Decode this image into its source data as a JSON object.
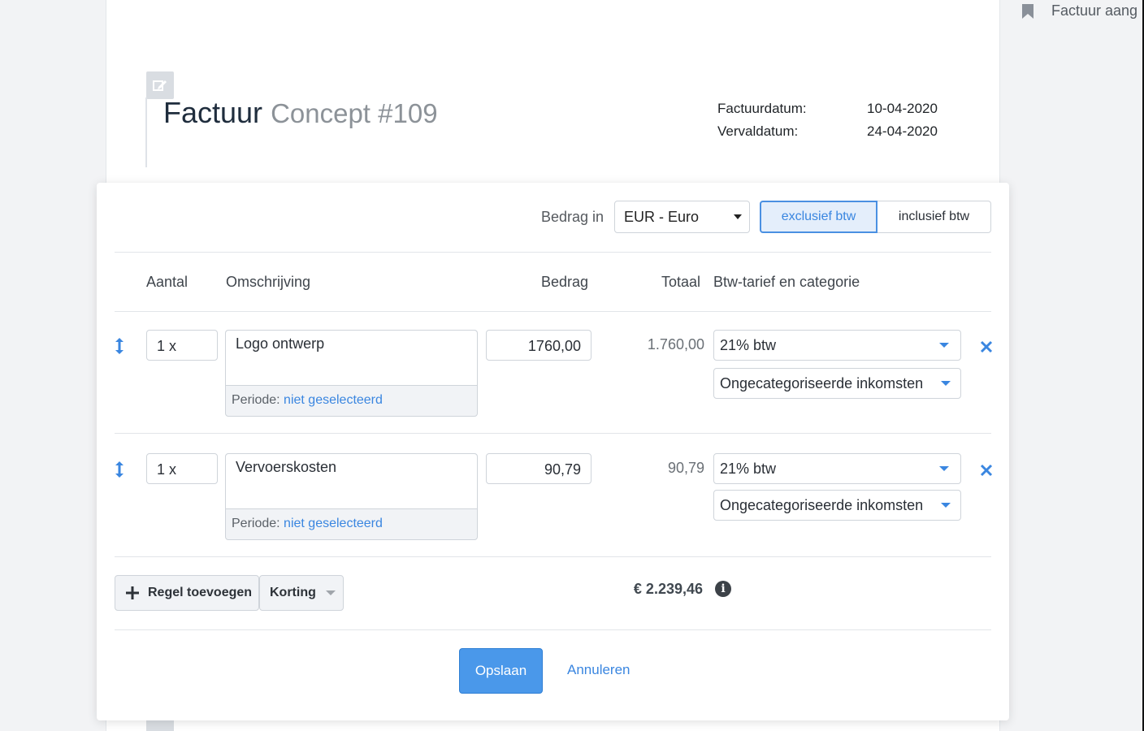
{
  "document": {
    "title": "Factuur",
    "subtitle": "Concept #109",
    "dates": [
      {
        "label": "Factuurdatum:",
        "value": "10-04-2020"
      },
      {
        "label": "Vervaldatum:",
        "value": "24-04-2020"
      }
    ]
  },
  "sidebar": {
    "item_label": "Factuur aang"
  },
  "editor": {
    "currency_label": "Bedrag in",
    "currency_value": "EUR - Euro",
    "tax_toggle": {
      "exclusive": "exclusief btw",
      "inclusive": "inclusief btw",
      "selected": "exclusief btw"
    },
    "columns": {
      "quantity": "Aantal",
      "description": "Omschrijving",
      "amount": "Bedrag",
      "total": "Totaal",
      "vat": "Btw-tarief en categorie"
    },
    "lines": [
      {
        "quantity": "1 x",
        "description": "Logo ontwerp",
        "period_label": "Periode:",
        "period_value": "niet geselecteerd",
        "amount": "1760,00",
        "total": "1.760,00",
        "vat": "21% btw",
        "category": "Ongecategoriseerde inkomsten"
      },
      {
        "quantity": "1 x",
        "description": "Vervoerskosten",
        "period_label": "Periode:",
        "period_value": "niet geselecteerd",
        "amount": "90,79",
        "total": "90,79",
        "vat": "21% btw",
        "category": "Ongecategoriseerde inkomsten"
      }
    ],
    "add_line_label": "Regel toevoegen",
    "discount_label": "Korting",
    "grand_total": "€ 2.239,46",
    "save_label": "Opslaan",
    "cancel_label": "Annuleren"
  },
  "colors": {
    "accent": "#3a86e0",
    "primary_button": "#4a98ea"
  }
}
